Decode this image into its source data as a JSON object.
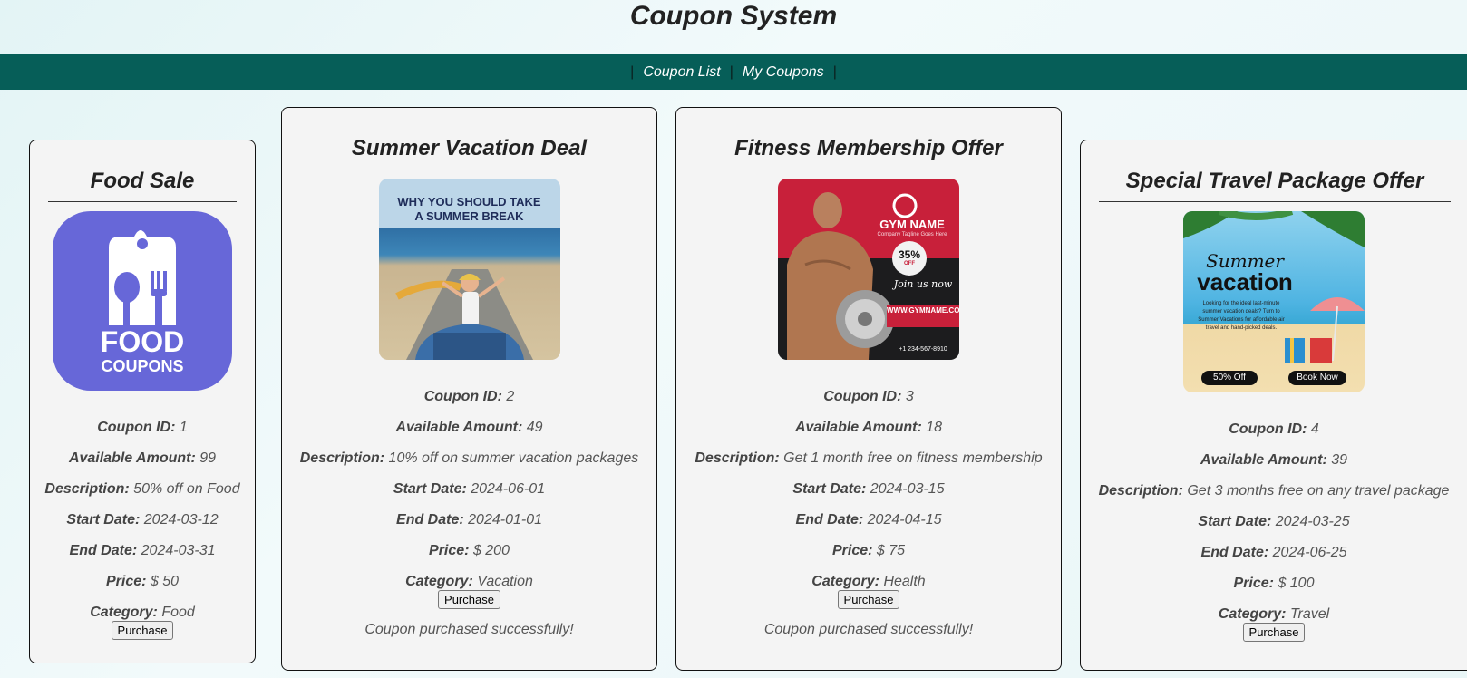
{
  "page": {
    "title": "Coupon System"
  },
  "nav": {
    "items": [
      "Coupon List",
      "My Coupons"
    ]
  },
  "labels": {
    "id": "Coupon ID:",
    "amount": "Available Amount:",
    "description": "Description:",
    "start": "Start Date:",
    "end": "End Date:",
    "price": "Price:",
    "category": "Category:",
    "purchase": "Purchase"
  },
  "coupons": [
    {
      "title": "Food Sale",
      "id": "1",
      "amount": "99",
      "description": "50% off on Food",
      "start": "2024-03-12",
      "end": "2024-03-31",
      "price": "$ 50",
      "category": "Food",
      "message": "",
      "image": {
        "line1": "FOOD",
        "line2": "COUPONS",
        "bg": "#6767d8"
      }
    },
    {
      "title": "Summer Vacation Deal",
      "id": "2",
      "amount": "49",
      "description": "10% off on summer vacation packages",
      "start": "2024-06-01",
      "end": "2024-01-01",
      "price": "$ 200",
      "category": "Vacation",
      "message": "Coupon purchased successfully!",
      "image": {
        "line1": "WHY YOU SHOULD TAKE",
        "line2": "A SUMMER BREAK"
      }
    },
    {
      "title": "Fitness Membership Offer",
      "id": "3",
      "amount": "18",
      "description": "Get 1 month free on fitness membership",
      "start": "2024-03-15",
      "end": "2024-04-15",
      "price": "$ 75",
      "category": "Health",
      "message": "Coupon purchased successfully!",
      "image": {
        "brand": "GYM NAME",
        "tagline": "Company Tagline Goes Here",
        "badge": "35%",
        "badge_sub": "OFF",
        "join": "Join us now",
        "site": "WWW.GYMNAME.COM",
        "phone": "+1 234-567-8910",
        "accent": "#c8203a"
      }
    },
    {
      "title": "Special Travel Package Offer",
      "id": "4",
      "amount": "39",
      "description": "Get 3 months free on any travel package",
      "start": "2024-03-25",
      "end": "2024-06-25",
      "price": "$ 100",
      "category": "Travel",
      "message": "",
      "image": {
        "line1": "Summer",
        "line2": "vacation",
        "body": "Looking for the ideal last-minute summer vacation deals? Turn to Summer Vacations for affordable air travel and hand-picked deals.",
        "pill1": "50% Off",
        "pill2": "Book Now"
      }
    }
  ]
}
